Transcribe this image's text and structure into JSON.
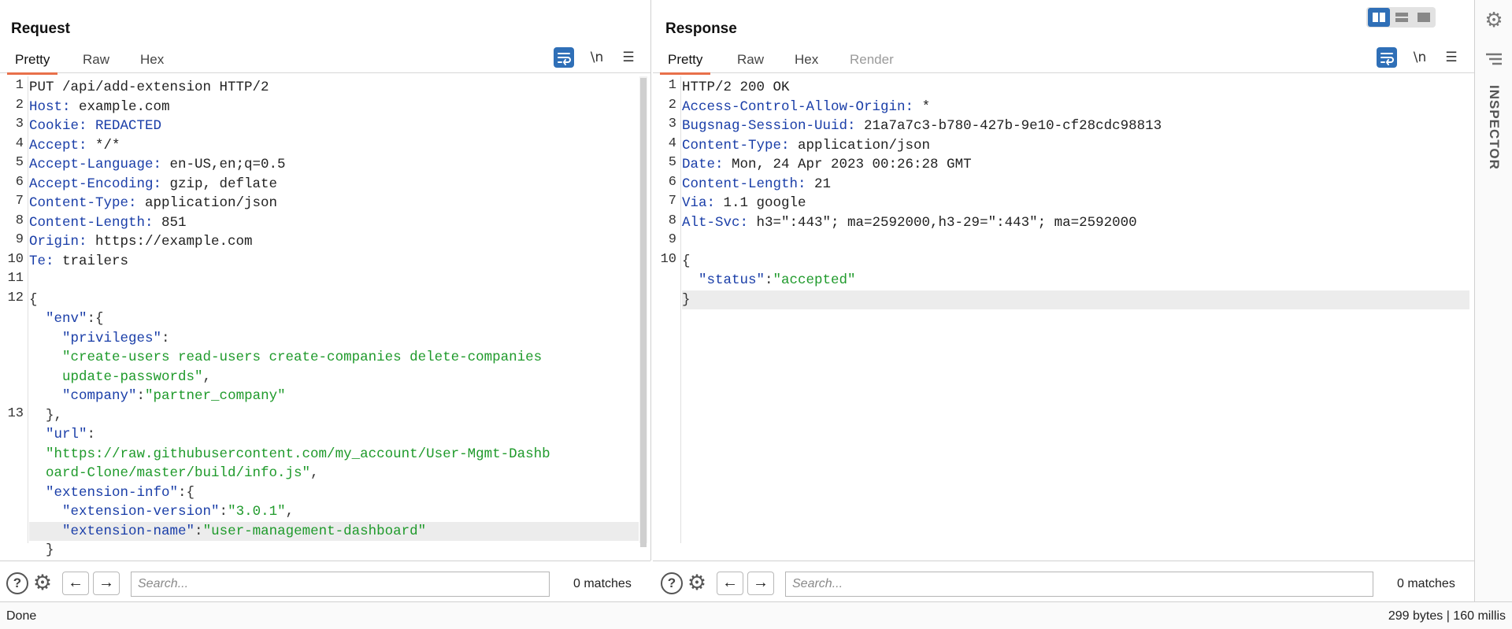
{
  "request": {
    "title": "Request",
    "tabs": [
      "Pretty",
      "Raw",
      "Hex"
    ],
    "active_tab": "Pretty",
    "tools": {
      "wrap": "wrap-icon",
      "newline": "\\n",
      "menu": "☰"
    },
    "lines": [
      {
        "n": "1",
        "parts": [
          {
            "c": "hv",
            "t": "PUT /api/add-extension HTTP/2"
          }
        ]
      },
      {
        "n": "2",
        "parts": [
          {
            "c": "hk",
            "t": "Host:"
          },
          {
            "c": "hv",
            "t": " example.com"
          }
        ]
      },
      {
        "n": "3",
        "parts": [
          {
            "c": "hk",
            "t": "Cookie:"
          },
          {
            "c": "hk",
            "t": " REDACTED"
          }
        ]
      },
      {
        "n": "4",
        "parts": [
          {
            "c": "hk",
            "t": "Accept:"
          },
          {
            "c": "hv",
            "t": " */*"
          }
        ]
      },
      {
        "n": "5",
        "parts": [
          {
            "c": "hk",
            "t": "Accept-Language:"
          },
          {
            "c": "hv",
            "t": " en-US,en;q=0.5"
          }
        ]
      },
      {
        "n": "6",
        "parts": [
          {
            "c": "hk",
            "t": "Accept-Encoding:"
          },
          {
            "c": "hv",
            "t": " gzip, deflate"
          }
        ]
      },
      {
        "n": "7",
        "parts": [
          {
            "c": "hk",
            "t": "Content-Type:"
          },
          {
            "c": "hv",
            "t": " application/json"
          }
        ]
      },
      {
        "n": "8",
        "parts": [
          {
            "c": "hk",
            "t": "Content-Length:"
          },
          {
            "c": "hv",
            "t": " 851"
          }
        ]
      },
      {
        "n": "9",
        "parts": [
          {
            "c": "hk",
            "t": "Origin:"
          },
          {
            "c": "hv",
            "t": " https://example.com"
          }
        ]
      },
      {
        "n": "10",
        "parts": [
          {
            "c": "hk",
            "t": "Te:"
          },
          {
            "c": "hv",
            "t": " trailers"
          }
        ]
      },
      {
        "n": "11",
        "parts": []
      },
      {
        "n": "12",
        "parts": [
          {
            "c": "punct",
            "t": "{"
          }
        ]
      },
      {
        "n": "",
        "parts": [
          {
            "c": "jk",
            "t": "  \"env\""
          },
          {
            "c": "punct",
            "t": ":{"
          }
        ]
      },
      {
        "n": "",
        "parts": [
          {
            "c": "jk",
            "t": "    \"privileges\""
          },
          {
            "c": "punct",
            "t": ":"
          }
        ]
      },
      {
        "n": "",
        "parts": [
          {
            "c": "js",
            "t": "    \"create-users read-users create-companies delete-companies"
          }
        ]
      },
      {
        "n": "",
        "parts": [
          {
            "c": "js",
            "t": "    update-passwords\""
          },
          {
            "c": "punct",
            "t": ","
          }
        ]
      },
      {
        "n": "",
        "parts": [
          {
            "c": "jk",
            "t": "    \"company\""
          },
          {
            "c": "punct",
            "t": ":"
          },
          {
            "c": "js",
            "t": "\"partner_company\""
          }
        ]
      },
      {
        "n": "13",
        "parts": [
          {
            "c": "punct",
            "t": "  },"
          }
        ]
      },
      {
        "n": "",
        "parts": [
          {
            "c": "jk",
            "t": "  \"url\""
          },
          {
            "c": "punct",
            "t": ":"
          }
        ]
      },
      {
        "n": "",
        "parts": [
          {
            "c": "js",
            "t": "  \"https://raw.githubusercontent.com/my_account/User-Mgmt-Dashb"
          }
        ]
      },
      {
        "n": "",
        "parts": [
          {
            "c": "js",
            "t": "  oard-Clone/master/build/info.js\""
          },
          {
            "c": "punct",
            "t": ","
          }
        ]
      },
      {
        "n": "",
        "parts": [
          {
            "c": "jk",
            "t": "  \"extension-info\""
          },
          {
            "c": "punct",
            "t": ":{"
          }
        ]
      },
      {
        "n": "",
        "parts": [
          {
            "c": "jk",
            "t": "    \"extension-version\""
          },
          {
            "c": "punct",
            "t": ":"
          },
          {
            "c": "js",
            "t": "\"3.0.1\""
          },
          {
            "c": "punct",
            "t": ","
          }
        ]
      },
      {
        "n": "",
        "hl": true,
        "parts": [
          {
            "c": "jk",
            "t": "    \"extension-name\""
          },
          {
            "c": "punct",
            "t": ":"
          },
          {
            "c": "js",
            "t": "\"user-management-dashboard\""
          }
        ]
      },
      {
        "n": "",
        "parts": [
          {
            "c": "punct",
            "t": "  }"
          }
        ]
      }
    ],
    "search_placeholder": "Search...",
    "matches": "0 matches"
  },
  "response": {
    "title": "Response",
    "tabs": [
      "Pretty",
      "Raw",
      "Hex",
      "Render"
    ],
    "active_tab": "Pretty",
    "disabled_tab": "Render",
    "tools": {
      "wrap": "wrap-icon",
      "newline": "\\n",
      "menu": "☰"
    },
    "lines": [
      {
        "n": "1",
        "parts": [
          {
            "c": "hv",
            "t": "HTTP/2 200 OK"
          }
        ]
      },
      {
        "n": "2",
        "parts": [
          {
            "c": "hk",
            "t": "Access-Control-Allow-Origin:"
          },
          {
            "c": "hv",
            "t": " *"
          }
        ]
      },
      {
        "n": "3",
        "parts": [
          {
            "c": "hk",
            "t": "Bugsnag-Session-Uuid:"
          },
          {
            "c": "hv",
            "t": " 21a7a7c3-b780-427b-9e10-cf28cdc98813"
          }
        ]
      },
      {
        "n": "4",
        "parts": [
          {
            "c": "hk",
            "t": "Content-Type:"
          },
          {
            "c": "hv",
            "t": " application/json"
          }
        ]
      },
      {
        "n": "5",
        "parts": [
          {
            "c": "hk",
            "t": "Date:"
          },
          {
            "c": "hv",
            "t": " Mon, 24 Apr 2023 00:26:28 GMT"
          }
        ]
      },
      {
        "n": "6",
        "parts": [
          {
            "c": "hk",
            "t": "Content-Length:"
          },
          {
            "c": "hv",
            "t": " 21"
          }
        ]
      },
      {
        "n": "7",
        "parts": [
          {
            "c": "hk",
            "t": "Via:"
          },
          {
            "c": "hv",
            "t": " 1.1 google"
          }
        ]
      },
      {
        "n": "8",
        "parts": [
          {
            "c": "hk",
            "t": "Alt-Svc:"
          },
          {
            "c": "hv",
            "t": " h3=\":443\"; ma=2592000,h3-29=\":443\"; ma=2592000"
          }
        ]
      },
      {
        "n": "9",
        "parts": []
      },
      {
        "n": "10",
        "parts": [
          {
            "c": "punct",
            "t": "{"
          }
        ]
      },
      {
        "n": "",
        "parts": [
          {
            "c": "jk",
            "t": "  \"status\""
          },
          {
            "c": "punct",
            "t": ":"
          },
          {
            "c": "js",
            "t": "\"accepted\""
          }
        ]
      },
      {
        "n": "",
        "hl": true,
        "parts": [
          {
            "c": "punct",
            "t": "}"
          }
        ]
      }
    ],
    "search_placeholder": "Search...",
    "matches": "0 matches"
  },
  "status_bar": {
    "left": "Done",
    "right": "299 bytes | 160 millis"
  },
  "inspector": {
    "label": "INSPECTOR"
  },
  "colors": {
    "accent_tab": "#e8704a",
    "button_blue": "#2f6fb7",
    "header_key": "#1a3ea8",
    "json_string": "#1f9a2b"
  }
}
